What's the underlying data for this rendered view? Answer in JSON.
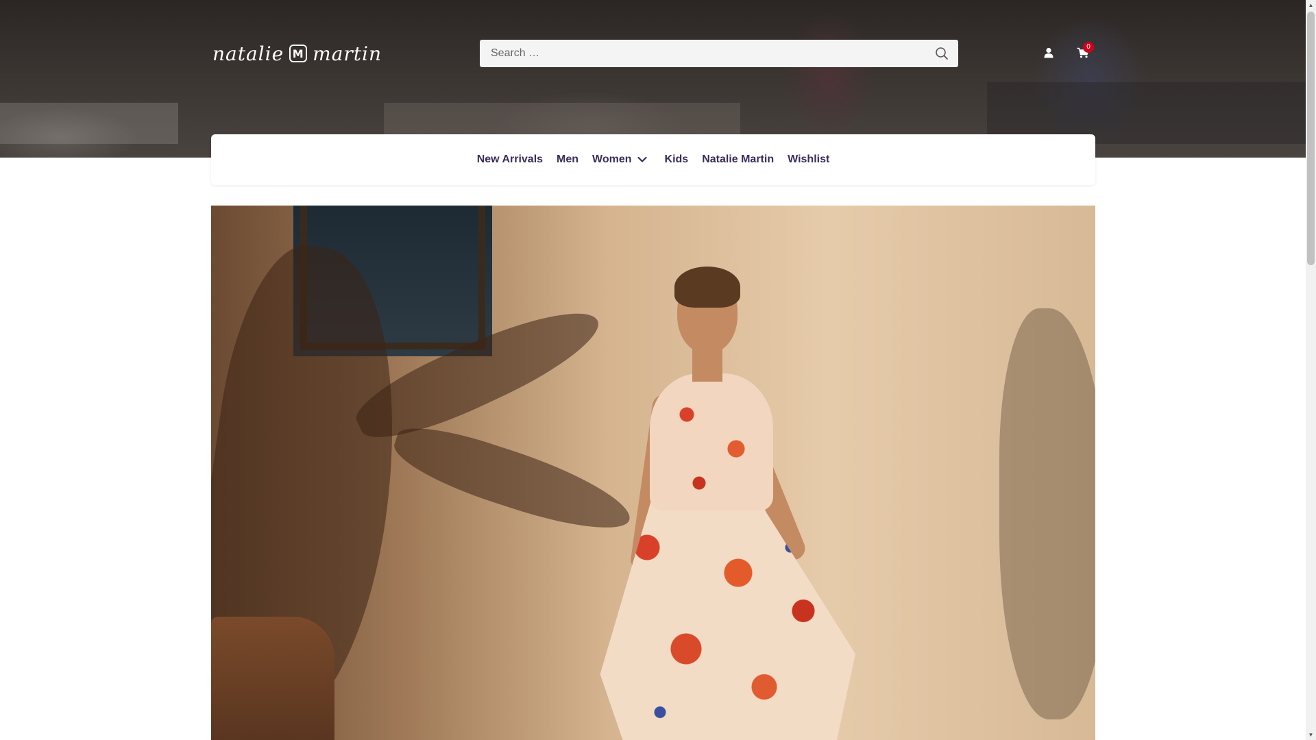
{
  "brand": {
    "logo_text_left": "natalie",
    "logo_mark": "M",
    "logo_text_right": "martin"
  },
  "search": {
    "placeholder": "Search …",
    "icon": "search-icon"
  },
  "header_actions": {
    "account_icon": "user-icon",
    "cart_icon": "cart-icon",
    "cart_count": "0"
  },
  "nav": {
    "items": [
      {
        "label": "New Arrivals"
      },
      {
        "label": "Men"
      },
      {
        "label": "Women",
        "has_dropdown": true
      },
      {
        "label": "Kids"
      },
      {
        "label": "Natalie Martin"
      },
      {
        "label": "Wishlist"
      }
    ]
  },
  "colors": {
    "nav_text": "#3a2c5a",
    "cart_badge": "#d0021b",
    "search_bg": "#f4f4f4"
  }
}
